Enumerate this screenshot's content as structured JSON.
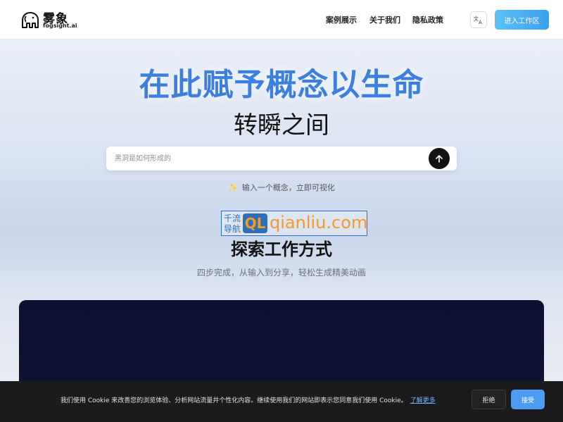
{
  "header": {
    "brand_name": "雾象",
    "brand_domain": "fogsight.ai",
    "nav": [
      "案例展示",
      "关于我们",
      "隐私政策"
    ],
    "language_icon": "translate-icon",
    "enter_label": "进入工作区"
  },
  "hero": {
    "title": "在此赋予概念以生命",
    "subtitle": "转瞬之间",
    "search_placeholder": "黑洞是如何形成的",
    "send_icon": "arrow-up-icon",
    "hint_icon": "sparkles-icon",
    "hint": "输入一个概念，立即可视化"
  },
  "watermark": {
    "cn_line1": "千流",
    "cn_line2": "导航",
    "badge": "QL",
    "url": "qianliu.com"
  },
  "section": {
    "title": "探索工作方式",
    "subtitle": "四步完成，从输入到分享，轻松生成精美动画"
  },
  "cookie": {
    "text": "我们使用 Cookie 来改善您的浏览体验、分析网站流量并个性化内容。继续使用我们的网站即表示您同意我们使用 Cookie。",
    "link": "了解更多",
    "reject": "拒绝",
    "accept": "接受"
  },
  "colors": {
    "accent": "#3d7fdf",
    "button_gradient_start": "#5ec1f5",
    "button_gradient_end": "#3a9ff0",
    "cookie_bg": "#1b1b1d",
    "accept": "#4d9cf2"
  }
}
